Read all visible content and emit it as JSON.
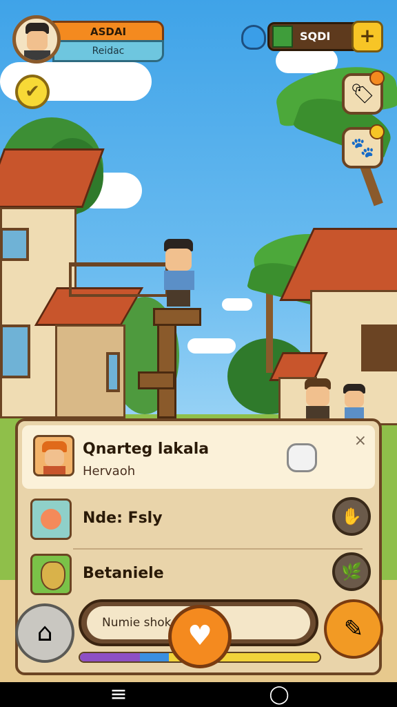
{
  "hud": {
    "player_name": "ASDAI",
    "player_subtitle": "Reidac",
    "currency_value": "SQDI"
  },
  "panel": {
    "header": {
      "title": "Qnarteg lakala",
      "subtitle": "Hervaoh",
      "close": "×"
    },
    "items": [
      {
        "label": "Nde: Fsly"
      },
      {
        "label": "Betaniele"
      }
    ]
  },
  "bottom": {
    "search_text": "Numie shok",
    "progress": {
      "purple": 0.25,
      "blue": 0.12
    }
  },
  "icons": [
    "check-icon",
    "gem-icon",
    "plus-icon",
    "shop-icon",
    "pet-icon",
    "close-icon",
    "home-icon",
    "heart-icon",
    "edit-icon",
    "menu-icon",
    "nav-home-icon"
  ],
  "colors": {
    "accent": "#f48a1f",
    "panel": "#e9d4aa",
    "wood": "#6b4423",
    "sky": "#5db4ee"
  }
}
